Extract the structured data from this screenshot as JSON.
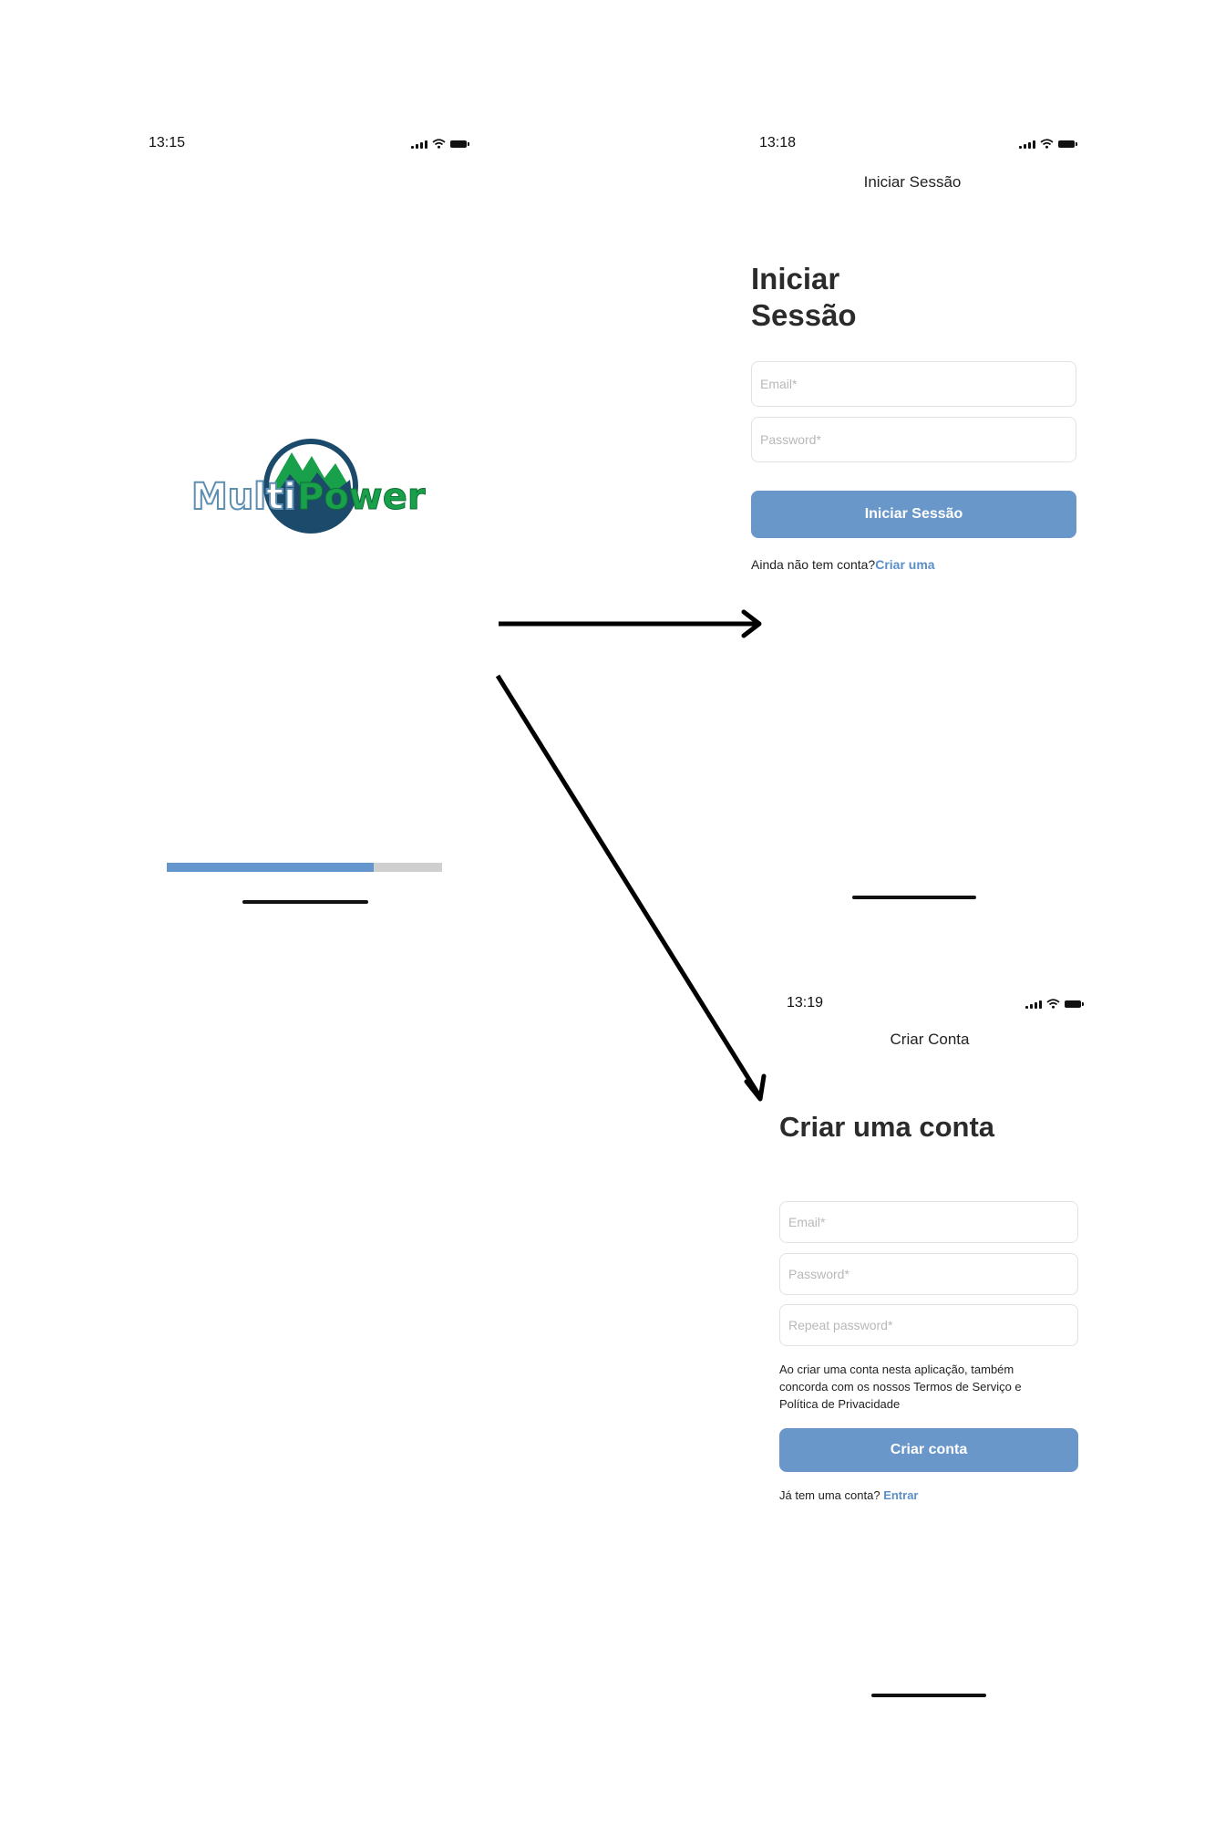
{
  "splash": {
    "time": "13:15",
    "logo_text": "MultiPower",
    "progress": 0.75
  },
  "login": {
    "time": "13:18",
    "nav_title": "Iniciar Sessão",
    "title_line1": "Iniciar",
    "title_line2": "Sessão",
    "email_placeholder": "Email*",
    "password_placeholder": "Password*",
    "submit_label": "Iniciar Sessão",
    "no_account_text": "Ainda não tem conta?",
    "create_link": "Criar uma"
  },
  "register": {
    "time": "13:19",
    "nav_title": "Criar Conta",
    "title": "Criar uma conta",
    "email_placeholder": "Email*",
    "password_placeholder": "Password*",
    "repeat_password_placeholder": "Repeat password*",
    "terms_text": "Ao criar uma conta nesta aplicação, também concorda com os nossos Termos de Serviço e Política de Privacidade",
    "submit_label": "Criar conta",
    "has_account_text": "Já tem uma conta?",
    "login_link": "Entrar"
  },
  "colors": {
    "accent": "#6a97c9",
    "link": "#5b8fc8",
    "logo_green": "#19a04b",
    "logo_navy": "#1b4a6b",
    "progress_track": "#cfcfcf"
  }
}
